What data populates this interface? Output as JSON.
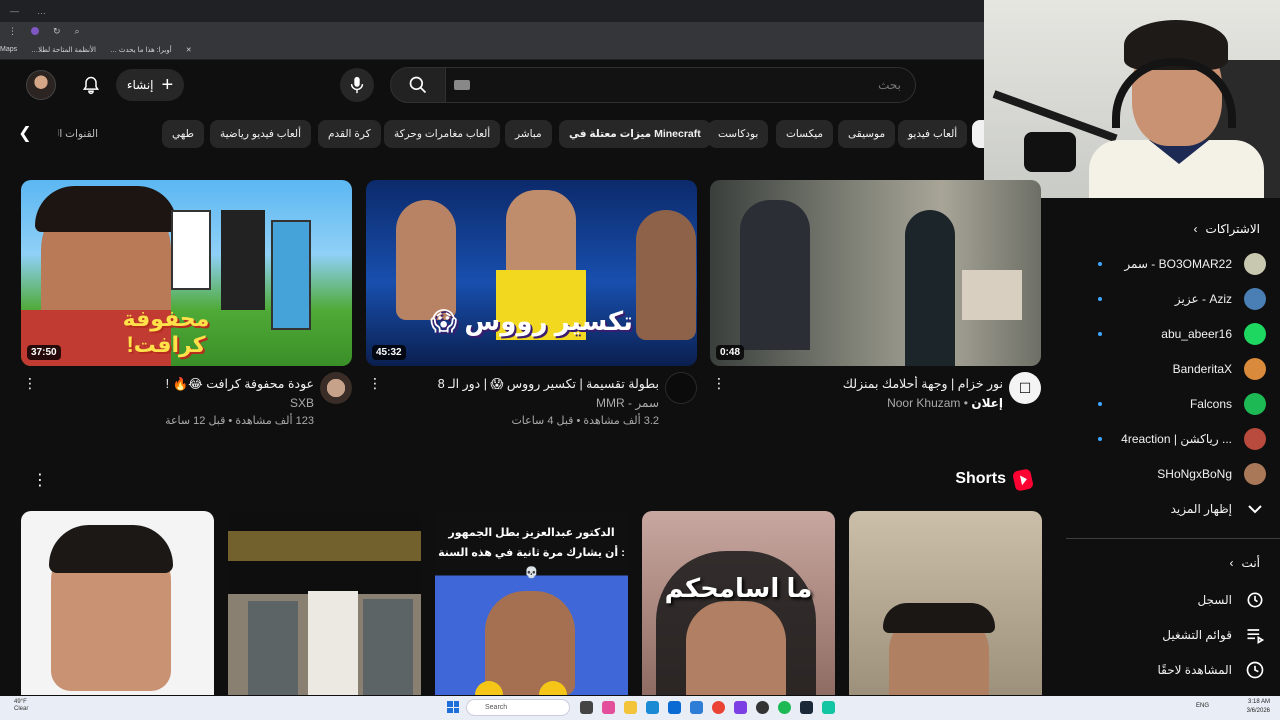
{
  "browser": {
    "tab_label": "…",
    "bookmarks": [
      "أوبرا: هذا ما يحدث …",
      "الأنظمة المتاحة لطلا…",
      "Maps"
    ]
  },
  "header": {
    "create_label": "إنشاء",
    "search_placeholder": "بحث"
  },
  "chips": [
    "ألعاب فيديو",
    "موسيقى",
    "ميكسات",
    "بودكاست",
    "ميزات معتلة في Minecraft",
    "مباشر",
    "ألعاب مغامرات وحركة",
    "كرة القدم",
    "ألعاب فيديو رياضية",
    "طهي",
    "القنوات التي تم تحميلها"
  ],
  "videos": [
    {
      "title": "عودة محفوفة كرافت 😂🔥 !",
      "channel": "SXB",
      "stats": "123 ألف مشاهدة • قبل 12 ساعة",
      "duration": "37:50",
      "thumb_text": "محفوفة كرافت!"
    },
    {
      "title": "بطولة تقسيمة | تكسير رووس 😱 | دور الـ 8",
      "channel": "سمر - MMR",
      "stats": "3.2 ألف مشاهدة • قبل 4 ساعات",
      "duration": "45:32",
      "thumb_text": "تكسير رووس 😱"
    },
    {
      "title": "نور خزام | وجهة أحلامك بمنزلك",
      "channel": "Noor Khuzam",
      "ad_label": "إعلان",
      "duration": "0:48"
    }
  ],
  "shorts": {
    "title": "Shorts",
    "items": [
      {
        "text": ""
      },
      {
        "text": ""
      },
      {
        "text": "الدكتور عبدالعزيز بطل الجمهور\n: أن يشارك مرة ثانية في هذه السنة 💀"
      },
      {
        "text": "ما اسامحكم"
      },
      {
        "text": ""
      }
    ]
  },
  "sidebar": {
    "subscriptions_label": "الاشتراكات",
    "subscriptions": [
      {
        "label": "سمر - BO3OMAR22",
        "color": "#c8c8b0"
      },
      {
        "label": "عزيز - Aziz",
        "color": "#4a7fb5"
      },
      {
        "label": "abu_abeer16",
        "color": "#1ed760"
      },
      {
        "label": "BanderitaX",
        "color": "#d98a3a"
      },
      {
        "label": "Falcons",
        "color": "#1db954"
      },
      {
        "label": "4reaction | رياكشن ...",
        "color": "#b84b3d"
      },
      {
        "label": "SHoNgxBoNg",
        "color": "#a87858"
      }
    ],
    "show_more": "إظهار المزيد",
    "you_label": "أنت",
    "you_items": [
      "السجل",
      "قوائم التشغيل",
      "المشاهدة لاحقًا"
    ]
  },
  "taskbar": {
    "weather_temp": "49°F",
    "weather_desc": "Clear",
    "search_label": "Search",
    "lang": "ENG",
    "time": "3:18 AM",
    "date": "3/6/2026"
  }
}
